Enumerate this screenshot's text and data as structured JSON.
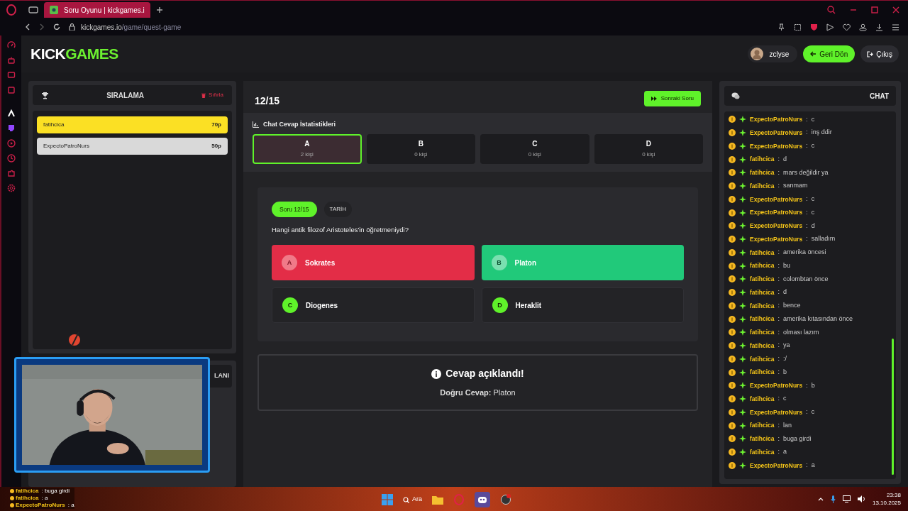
{
  "browser": {
    "tab_title": "Soru Oyunu | kickgames.i",
    "url_host": "kickgames.io",
    "url_path": "/game/quest-game"
  },
  "header": {
    "logo_left": "KICK",
    "logo_right": "GAMES",
    "user": "zclyse",
    "back_button": "Geri Dön",
    "logout_button": "Çıkış"
  },
  "leaderboard": {
    "title": "SIRALAMA",
    "reset": "Sıfırla",
    "entries": [
      {
        "name": "fatihcica",
        "score": "70p",
        "color": "#fbe024"
      },
      {
        "name": "ExpectoPatroNurs",
        "score": "50p",
        "color": "#d9d9d9"
      }
    ]
  },
  "lower_card": {
    "title": "LANI"
  },
  "game": {
    "progress": "12/15",
    "next_button": "Sonraki Soru",
    "stats": {
      "title": "Chat Cevap İstatistikleri",
      "options": [
        {
          "letter": "A",
          "count": "2 kişi",
          "selected": true
        },
        {
          "letter": "B",
          "count": "0 kişi",
          "selected": false
        },
        {
          "letter": "C",
          "count": "0 kişi",
          "selected": false
        },
        {
          "letter": "D",
          "count": "0 kişi",
          "selected": false
        }
      ]
    },
    "question": {
      "badge": "Soru 12/15",
      "category": "TARİH",
      "text": "Hangi antik filozof Aristoteles'in öğretmeniydi?",
      "answers": [
        {
          "letter": "A",
          "text": "Sokrates",
          "kind": "wrong"
        },
        {
          "letter": "B",
          "text": "Platon",
          "kind": "correct"
        },
        {
          "letter": "C",
          "text": "Diogenes",
          "kind": "plain"
        },
        {
          "letter": "D",
          "text": "Heraklit",
          "kind": "plain"
        }
      ]
    },
    "reveal": {
      "title": "Cevap açıklandı!",
      "answer": "**Doğru Cevap:** Platon"
    }
  },
  "chat": {
    "title": "CHAT",
    "messages": [
      {
        "user": "ExpectoPatroNurs",
        "text": ":  c"
      },
      {
        "user": "ExpectoPatroNurs",
        "text": ":  inş ddir"
      },
      {
        "user": "ExpectoPatroNurs",
        "text": ":  c"
      },
      {
        "user": "fatihcica",
        "text": ":  d"
      },
      {
        "user": "fatihcica",
        "text": ":  mars değildir ya"
      },
      {
        "user": "fatihcica",
        "text": ":  sanmam"
      },
      {
        "user": "ExpectoPatroNurs",
        "text": ":  c"
      },
      {
        "user": "ExpectoPatroNurs",
        "text": ":  c"
      },
      {
        "user": "ExpectoPatroNurs",
        "text": ":  d"
      },
      {
        "user": "ExpectoPatroNurs",
        "text": ":  salladım"
      },
      {
        "user": "fatihcica",
        "text": ":  amerika öncesi"
      },
      {
        "user": "fatihcica",
        "text": ":  bu"
      },
      {
        "user": "fatihcica",
        "text": ":  colombtan önce"
      },
      {
        "user": "fatihcica",
        "text": ":  d"
      },
      {
        "user": "fatihcica",
        "text": ":  bence"
      },
      {
        "user": "fatihcica",
        "text": ":  amerika kıtasından önce"
      },
      {
        "user": "fatihcica",
        "text": ":  olması lazım"
      },
      {
        "user": "fatihcica",
        "text": ":  ya"
      },
      {
        "user": "fatihcica",
        "text": ":  :/"
      },
      {
        "user": "fatihcica",
        "text": ":  b"
      },
      {
        "user": "ExpectoPatroNurs",
        "text": ":  b"
      },
      {
        "user": "fatihcica",
        "text": ":  c"
      },
      {
        "user": "ExpectoPatroNurs",
        "text": ":  c"
      },
      {
        "user": "fatihcica",
        "text": ":  lan"
      },
      {
        "user": "fatihcica",
        "text": ":  buga girdi"
      },
      {
        "user": "fatihcica",
        "text": ":  a"
      },
      {
        "user": "ExpectoPatroNurs",
        "text": ":  a"
      }
    ]
  },
  "stream_chat": [
    {
      "user": "fatihcica",
      "text": ": buga girdi"
    },
    {
      "user": "fatihcica",
      "text": ": a"
    },
    {
      "user": "ExpectoPatroNurs",
      "text": ": a"
    }
  ],
  "taskbar": {
    "search": "Ara",
    "time": "23:38",
    "date": "13.10.2025"
  }
}
